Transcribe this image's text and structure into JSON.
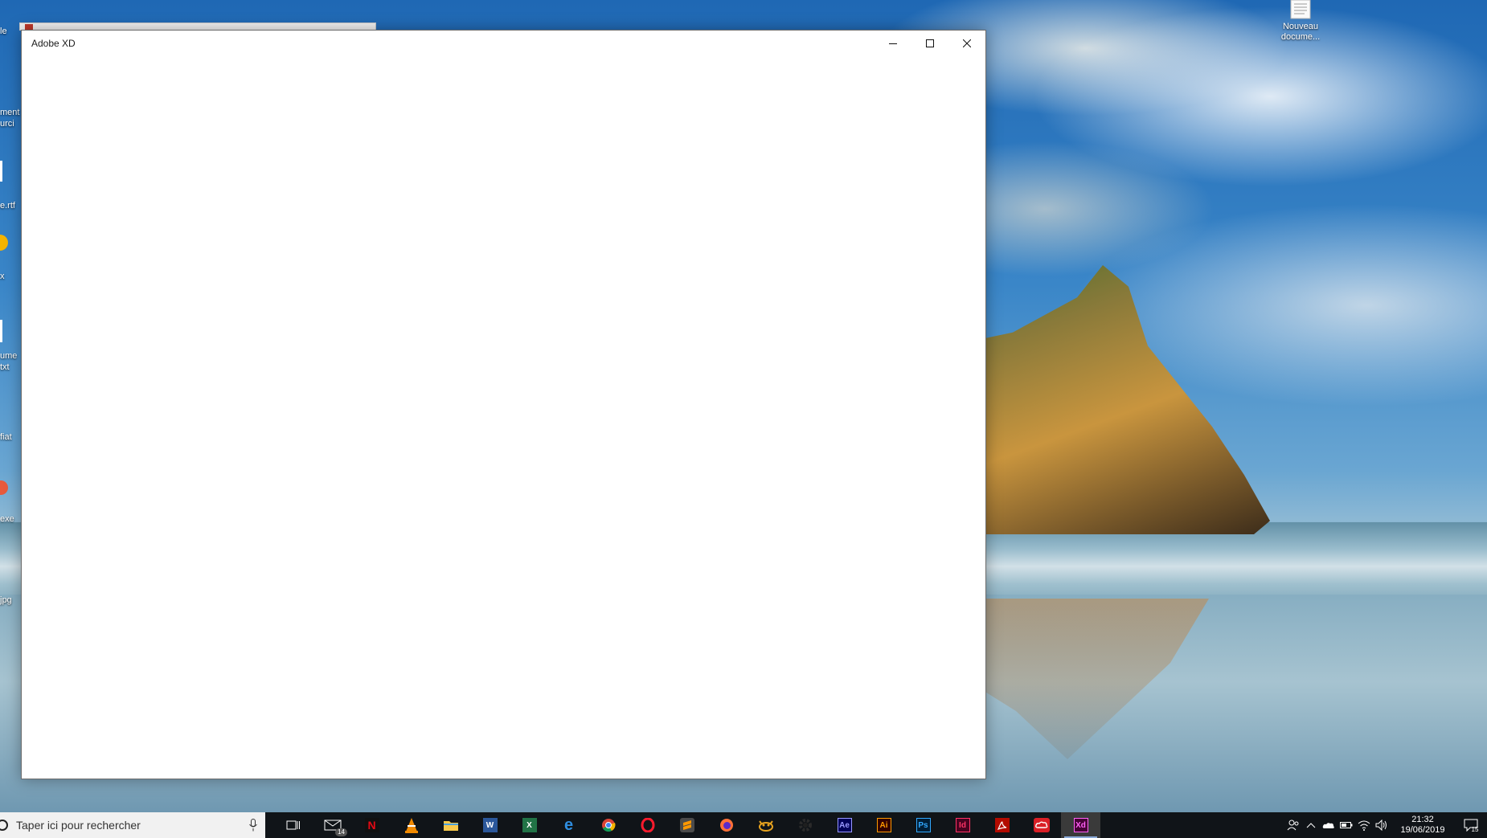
{
  "desktop": {
    "right_icon_label": "Nouveau docume...",
    "left_labels": [
      "le",
      "ment",
      "urci",
      "e.rtf",
      "x",
      "ume",
      "txt",
      "fiat",
      "exe",
      "jpg"
    ]
  },
  "window": {
    "title": "Adobe XD",
    "minimize_label": "Réduire",
    "maximize_label": "Agrandir",
    "close_label": "Fermer"
  },
  "taskbar": {
    "search_placeholder": "Taper ici pour rechercher",
    "mail_badge": "14",
    "apps": [
      {
        "name": "task-view",
        "icon": "task-view-icon"
      },
      {
        "name": "mail",
        "icon": "mail-icon"
      },
      {
        "name": "netflix",
        "icon": "netflix-icon"
      },
      {
        "name": "vlc",
        "icon": "vlc-icon"
      },
      {
        "name": "file-explorer",
        "icon": "folder-icon"
      },
      {
        "name": "word",
        "icon": "word-icon"
      },
      {
        "name": "excel",
        "icon": "excel-icon"
      },
      {
        "name": "edge",
        "icon": "edge-icon"
      },
      {
        "name": "chrome",
        "icon": "chrome-icon"
      },
      {
        "name": "opera",
        "icon": "opera-icon"
      },
      {
        "name": "sublime",
        "icon": "sublime-icon"
      },
      {
        "name": "firefox",
        "icon": "firefox-icon"
      },
      {
        "name": "gimp",
        "icon": "gimp-icon"
      },
      {
        "name": "settings",
        "icon": "gear-icon"
      },
      {
        "name": "after-effects",
        "icon": "after-effects-icon"
      },
      {
        "name": "illustrator",
        "icon": "illustrator-icon"
      },
      {
        "name": "photoshop",
        "icon": "photoshop-icon"
      },
      {
        "name": "indesign",
        "icon": "indesign-icon"
      },
      {
        "name": "acrobat",
        "icon": "acrobat-icon"
      },
      {
        "name": "creative-cloud",
        "icon": "creative-cloud-icon"
      },
      {
        "name": "xd",
        "icon": "xd-icon"
      }
    ],
    "tile_text": {
      "netflix": "N",
      "word": "W",
      "excel": "X",
      "edge": "e",
      "after_effects": "Ae",
      "illustrator": "Ai",
      "photoshop": "Ps",
      "indesign": "Id",
      "xd": "Xd"
    },
    "clock_time": "21:32",
    "clock_date": "19/06/2019",
    "notification_count": "15"
  },
  "colors": {
    "taskbar_bg": "#101418",
    "ae": "#9999ff",
    "ai": "#ff9a00",
    "ps": "#31a8ff",
    "id": "#ff3366",
    "xd": "#ff61f6"
  }
}
